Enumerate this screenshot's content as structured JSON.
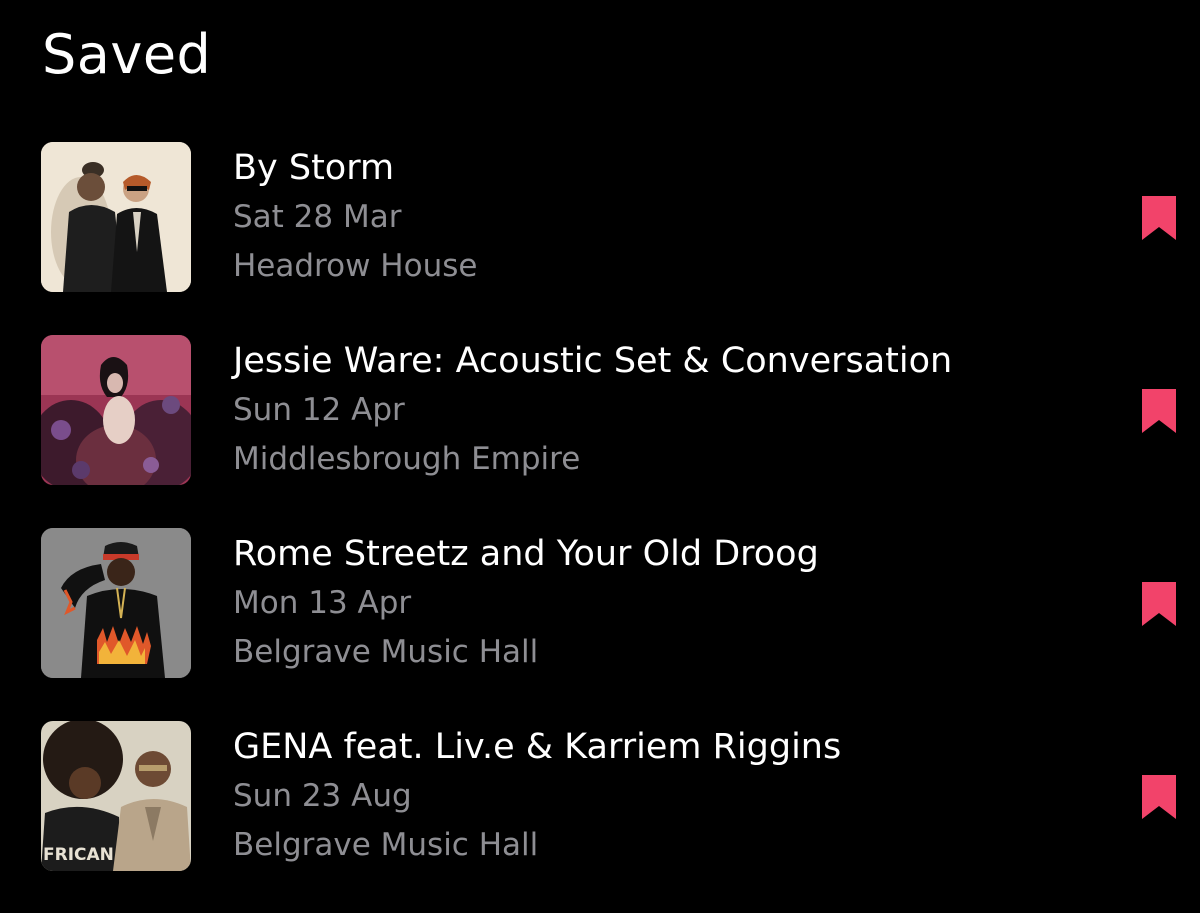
{
  "page": {
    "title": "Saved"
  },
  "colors": {
    "background": "#000000",
    "primary_text": "#ffffff",
    "secondary_text": "#8e8e93",
    "bookmark_accent": "#f2436a"
  },
  "events": [
    {
      "title": "By Storm",
      "date": "Sat 28 Mar",
      "venue": "Headrow House",
      "image": "two-men-portrait-photo",
      "bookmark_icon": "bookmark-filled-icon"
    },
    {
      "title": "Jessie Ware: Acoustic Set & Conversation",
      "date": "Sun 12 Apr",
      "venue": "Middlesbrough Empire",
      "image": "woman-in-flowers-photo",
      "bookmark_icon": "bookmark-filled-icon"
    },
    {
      "title": "Rome Streetz and Your Old Droog",
      "date": "Mon 13 Apr",
      "venue": "Belgrave Music Hall",
      "image": "man-flame-sweater-photo",
      "bookmark_icon": "bookmark-filled-icon"
    },
    {
      "title": "GENA feat. Liv.e & Karriem Riggins",
      "date": "Sun 23 Aug",
      "venue": "Belgrave Music Hall",
      "image": "duo-portrait-photo",
      "image_text": "FRICAN",
      "bookmark_icon": "bookmark-filled-icon"
    }
  ]
}
